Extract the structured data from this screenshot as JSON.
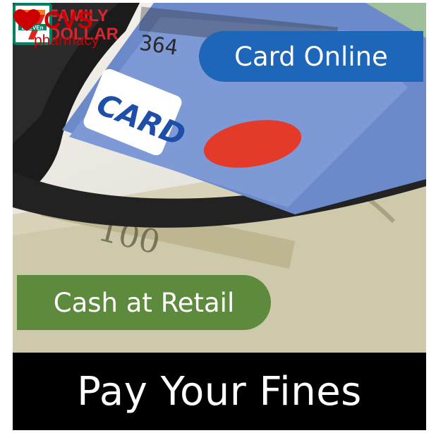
{
  "banner": {
    "title": "Pay Your Fines"
  },
  "badges": {
    "card_online": "Card Online",
    "cash_at_retail": "Cash at Retail"
  },
  "photo": {
    "card_text": "CARD",
    "card_number": "364"
  },
  "retail_logos": {
    "family_dollar_top": "FAMILY",
    "family_dollar_bottom": "DOLLAR",
    "seven_eleven": "ELEVEn",
    "cvs_top": "CVS",
    "cvs_bottom": "pharmacy"
  },
  "colors": {
    "card_online_bg": "#1e66b8",
    "cash_retail_bg": "#5e8a3e",
    "family_dollar": "#d7262e",
    "cvs": "#cc0000",
    "seven_eleven_green": "#008163",
    "seven_eleven_orange": "#f47721"
  }
}
